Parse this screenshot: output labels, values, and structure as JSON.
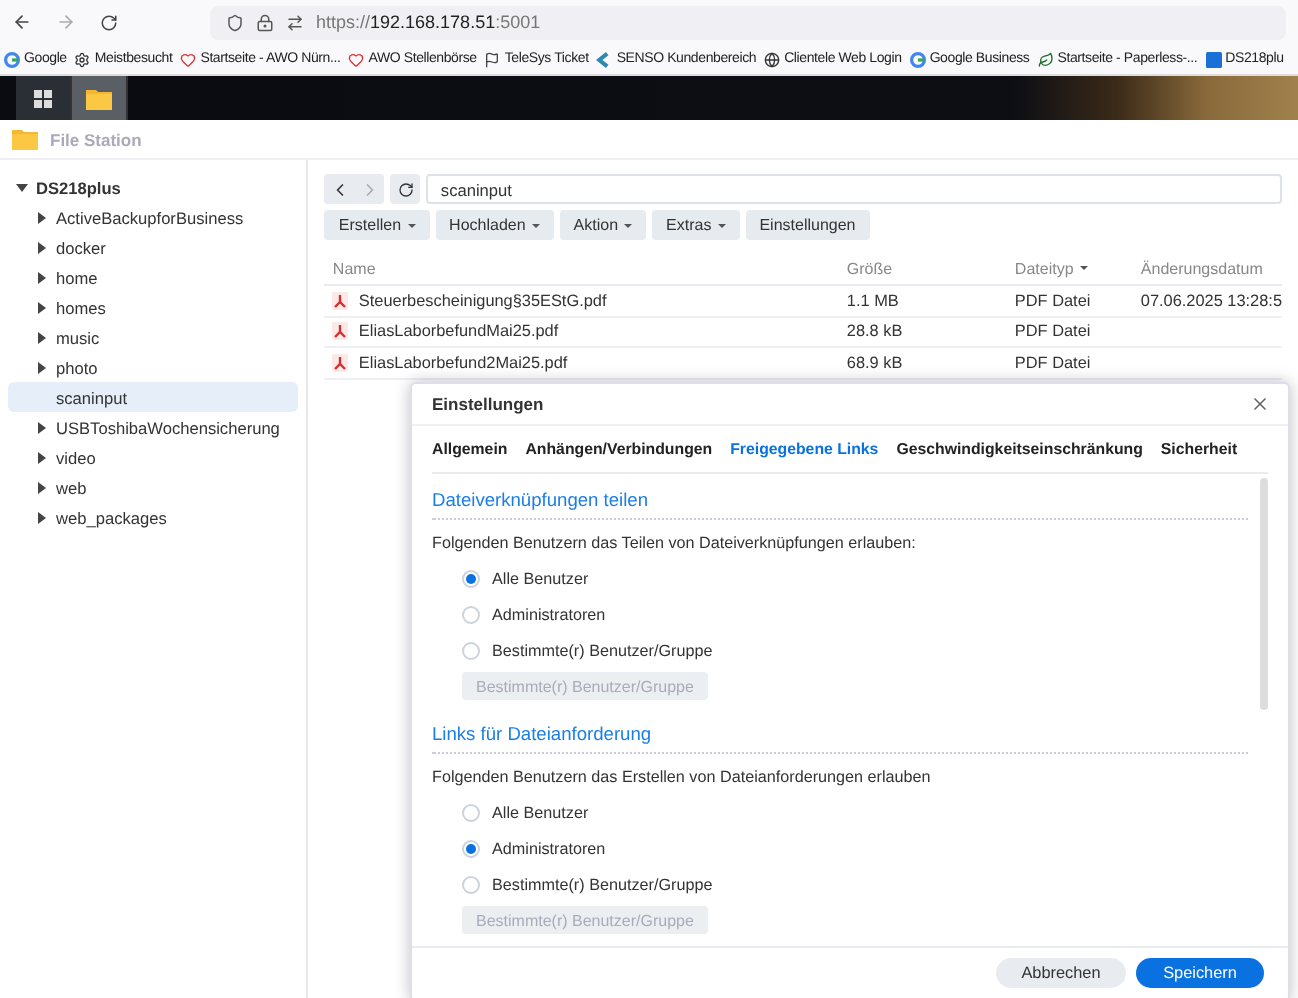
{
  "browser": {
    "url": "https://**192.168.178.51**:5001",
    "bookmarks": [
      {
        "kind": "g",
        "label": "Google"
      },
      {
        "kind": "gear",
        "label": "Meistbesucht"
      },
      {
        "kind": "heart",
        "label": "Startseite - AWO Nürn..."
      },
      {
        "kind": "heart",
        "label": "AWO Stellenbörse"
      },
      {
        "kind": "flag",
        "label": "TeleSys Ticket"
      },
      {
        "kind": "chevron",
        "label": "SENSO Kundenbereich"
      },
      {
        "kind": "globe",
        "label": "Clientele Web Login"
      },
      {
        "kind": "g",
        "label": "Google Business"
      },
      {
        "kind": "leaf",
        "label": "Startseite - Paperless-..."
      },
      {
        "kind": "ds",
        "label": "DS218plu"
      }
    ]
  },
  "taskbar": {
    "items": [
      {
        "kind": "apps",
        "selected": false
      },
      {
        "kind": "folder",
        "selected": true
      }
    ]
  },
  "window": {
    "title": "File Station"
  },
  "sidebar": {
    "root": {
      "label": "DS218plus",
      "expanded": true,
      "children": [
        {
          "label": "ActiveBackupforBusiness",
          "expandable": true,
          "selected": false
        },
        {
          "label": "docker",
          "expandable": true,
          "selected": false
        },
        {
          "label": "home",
          "expandable": true,
          "selected": false
        },
        {
          "label": "homes",
          "expandable": true,
          "selected": false
        },
        {
          "label": "music",
          "expandable": true,
          "selected": false
        },
        {
          "label": "photo",
          "expandable": true,
          "selected": false
        },
        {
          "label": "scaninput",
          "expandable": false,
          "selected": true
        },
        {
          "label": "USBToshibaWochensicherung",
          "expandable": true,
          "selected": false
        },
        {
          "label": "video",
          "expandable": true,
          "selected": false
        },
        {
          "label": "web",
          "expandable": true,
          "selected": false
        },
        {
          "label": "web_packages",
          "expandable": true,
          "selected": false
        }
      ]
    }
  },
  "toolbar": {
    "path": "scaninput",
    "back_disabled": false,
    "forward_disabled": true,
    "buttons": [
      {
        "label": "Erstellen",
        "dropdown": true
      },
      {
        "label": "Hochladen",
        "dropdown": true
      },
      {
        "label": "Aktion",
        "dropdown": true
      },
      {
        "label": "Extras",
        "dropdown": true
      },
      {
        "label": "Einstellungen",
        "dropdown": false
      }
    ]
  },
  "table": {
    "columns": [
      {
        "label": "Name",
        "sorted": false
      },
      {
        "label": "Größe",
        "sorted": false
      },
      {
        "label": "Dateityp",
        "sorted": true
      },
      {
        "label": "Änderungsdatum",
        "sorted": false
      }
    ],
    "rows": [
      {
        "name": "Steuerbescheinigung§35EStG.pdf",
        "size": "1.1 MB",
        "type": "PDF Datei",
        "modified": "07.06.2025 13:28:5"
      },
      {
        "name": "EliasLaborbefundMai25.pdf",
        "size": "28.8 kB",
        "type": "PDF Datei",
        "modified": ""
      },
      {
        "name": "EliasLaborbefund2Mai25.pdf",
        "size": "68.9 kB",
        "type": "PDF Datei",
        "modified": ""
      }
    ]
  },
  "dialog": {
    "title": "Einstellungen",
    "tabs": [
      {
        "label": "Allgemein",
        "selected": false
      },
      {
        "label": "Anhängen/Verbindungen",
        "selected": false
      },
      {
        "label": "Freigegebene Links",
        "selected": true
      },
      {
        "label": "Geschwindigkeitseinschränkung",
        "selected": false
      },
      {
        "label": "Sicherheit",
        "selected": false
      }
    ],
    "sections": [
      {
        "heading": "Dateiverknüpfungen teilen",
        "description": "Folgenden Benutzern das Teilen von Dateiverknüpfungen erlauben:",
        "options": [
          {
            "label": "Alle Benutzer",
            "selected": true
          },
          {
            "label": "Administratoren",
            "selected": false
          },
          {
            "label": "Bestimmte(r) Benutzer/Gruppe",
            "selected": false
          }
        ],
        "button": {
          "label": "Bestimmte(r) Benutzer/Gruppe",
          "disabled": true
        }
      },
      {
        "heading": "Links für Dateianforderung",
        "description": "Folgenden Benutzern das Erstellen von Dateianforderungen erlauben",
        "options": [
          {
            "label": "Alle Benutzer",
            "selected": false
          },
          {
            "label": "Administratoren",
            "selected": true
          },
          {
            "label": "Bestimmte(r) Benutzer/Gruppe",
            "selected": false
          }
        ],
        "button": {
          "label": "Bestimmte(r) Benutzer/Gruppe",
          "disabled": true
        }
      }
    ],
    "buttons": [
      {
        "label": "Abbrechen",
        "kind": "secondary"
      },
      {
        "label": "Speichern",
        "kind": "primary"
      }
    ]
  }
}
